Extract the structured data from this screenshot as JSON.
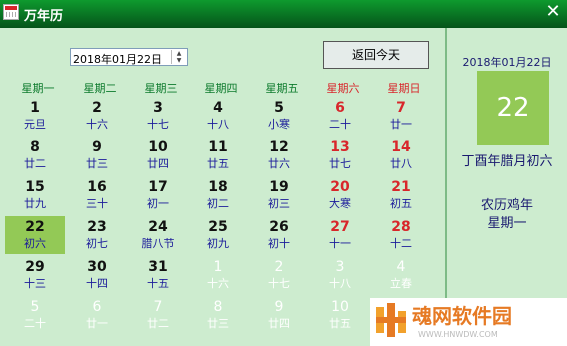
{
  "window": {
    "title": "万年历",
    "close_glyph": "✕"
  },
  "date_input": {
    "value": "2018年01月22日"
  },
  "today_button": "返回今天",
  "weekdays": [
    {
      "label": "星期一",
      "color": "#0c7a2c"
    },
    {
      "label": "星期二",
      "color": "#0c7a2c"
    },
    {
      "label": "星期三",
      "color": "#0c7a2c"
    },
    {
      "label": "星期四",
      "color": "#0c7a2c"
    },
    {
      "label": "星期五",
      "color": "#0c7a2c"
    },
    {
      "label": "星期六",
      "color": "#d8262b"
    },
    {
      "label": "星期日",
      "color": "#d8262b"
    }
  ],
  "colors": {
    "normal": "#111111",
    "normal_lunar": "#1a1a9a",
    "weekend": "#d8262b",
    "other_month": "#ffffff",
    "selected_bg": "#93c956"
  },
  "calendar_rows": [
    [
      [
        "1",
        "元旦",
        "n"
      ],
      [
        "2",
        "十六",
        "n"
      ],
      [
        "3",
        "十七",
        "n"
      ],
      [
        "4",
        "十八",
        "n"
      ],
      [
        "5",
        "小寒",
        "n"
      ],
      [
        "6",
        "二十",
        "w"
      ],
      [
        "7",
        "廿一",
        "w"
      ]
    ],
    [
      [
        "8",
        "廿二",
        "n"
      ],
      [
        "9",
        "廿三",
        "n"
      ],
      [
        "10",
        "廿四",
        "n"
      ],
      [
        "11",
        "廿五",
        "n"
      ],
      [
        "12",
        "廿六",
        "n"
      ],
      [
        "13",
        "廿七",
        "w"
      ],
      [
        "14",
        "廿八",
        "w"
      ]
    ],
    [
      [
        "15",
        "廿九",
        "n"
      ],
      [
        "16",
        "三十",
        "n"
      ],
      [
        "17",
        "初一",
        "n"
      ],
      [
        "18",
        "初二",
        "n"
      ],
      [
        "19",
        "初三",
        "n"
      ],
      [
        "20",
        "大寒",
        "w"
      ],
      [
        "21",
        "初五",
        "w"
      ]
    ],
    [
      [
        "22",
        "初六",
        "s"
      ],
      [
        "23",
        "初七",
        "n"
      ],
      [
        "24",
        "腊八节",
        "n"
      ],
      [
        "25",
        "初九",
        "n"
      ],
      [
        "26",
        "初十",
        "n"
      ],
      [
        "27",
        "十一",
        "w"
      ],
      [
        "28",
        "十二",
        "w"
      ]
    ],
    [
      [
        "29",
        "十三",
        "n"
      ],
      [
        "30",
        "十四",
        "n"
      ],
      [
        "31",
        "十五",
        "n"
      ],
      [
        "1",
        "十六",
        "o"
      ],
      [
        "2",
        "十七",
        "o"
      ],
      [
        "3",
        "十八",
        "o"
      ],
      [
        "4",
        "立春",
        "o"
      ]
    ],
    [
      [
        "5",
        "二十",
        "o"
      ],
      [
        "6",
        "廿一",
        "o"
      ],
      [
        "7",
        "廿二",
        "o"
      ],
      [
        "8",
        "廿三",
        "o"
      ],
      [
        "9",
        "廿四",
        "o"
      ],
      [
        "10",
        "廿五",
        "o"
      ],
      [
        "",
        "",
        ""
      ]
    ]
  ],
  "side_panel": {
    "date": "2018年01月22日",
    "day": "22",
    "lunar_date": "丁酉年腊月初六",
    "zodiac_year": "农历鸡年",
    "weekday": "星期一"
  },
  "watermark": {
    "text": "魂网软件园",
    "url": "WWW.HNWDW.COM"
  }
}
